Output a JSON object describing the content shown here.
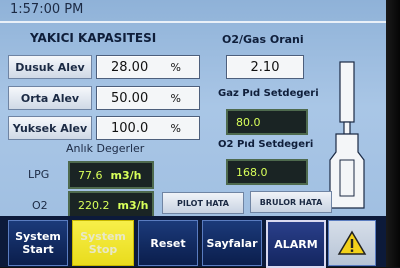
{
  "header": {
    "time": "1:57:00 PM"
  },
  "capacity": {
    "title": "YAKICI KAPASITESI",
    "rows": [
      {
        "label": "Dusuk Alev",
        "value": "28.00",
        "unit": "%"
      },
      {
        "label": "Orta Alev",
        "value": "50.00",
        "unit": "%"
      },
      {
        "label": "Yuksek Alev",
        "value": "100.0",
        "unit": "%"
      }
    ]
  },
  "ratio": {
    "title": "O2/Gas Orani",
    "value": "2.10"
  },
  "gas_pid": {
    "title": "Gaz Pıd Setdegeri",
    "value": "80.0"
  },
  "o2_pid": {
    "title": "O2 Pıd Setdegeri",
    "value": "168.0"
  },
  "instant": {
    "title": "Anlık Degerler",
    "lpg": {
      "label": "LPG",
      "value": "77.6",
      "unit": "m3/h"
    },
    "o2": {
      "label": "O2",
      "value": "220.2",
      "unit": "m3/h"
    }
  },
  "faults": {
    "pilot": "PILOT HATA",
    "burner": "BRULOR HATA"
  },
  "nav": {
    "start": "System Start",
    "stop": "System Stop",
    "reset": "Reset",
    "pages": "Sayfalar",
    "alarm": "ALARM"
  },
  "colors": {
    "accent": "#0c1a3a",
    "screen": "#a9c6e6",
    "digit": "#d8ff5a"
  },
  "icons": {
    "warning": "warning-triangle-icon",
    "burner": "burner-diagram-icon"
  }
}
